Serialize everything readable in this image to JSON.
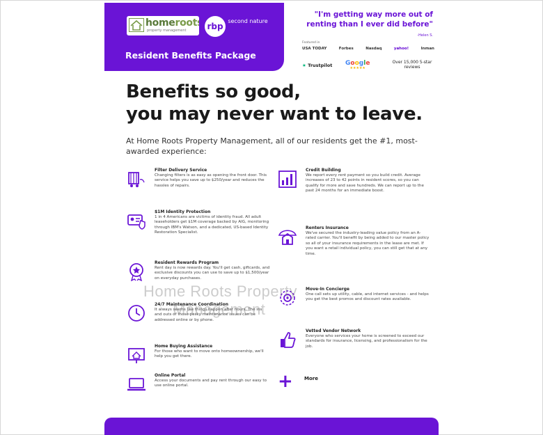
{
  "brand": {
    "logo_home": "home",
    "logo_roots": "roots",
    "logo_sub": "property management",
    "rbp": "rbp",
    "second_nature": "second nature",
    "package_title": "Resident Benefits Package"
  },
  "testimonial": {
    "quote": "\"I'm getting way more out of renting than I ever did before\"",
    "author": "-Helen S.",
    "featured_label": "Featured in",
    "press": [
      "USA TODAY",
      "Forbes",
      "Nasdaq",
      "yahoo!",
      "Inman"
    ],
    "trustpilot": "Trustpilot",
    "google": "Google",
    "google_stars": "★★★★★",
    "reviews": "Over 15,000 5-star reviews"
  },
  "headline_1": "Benefits so good,",
  "headline_2": "you may never want to leave.",
  "intro": "At Home Roots Property Management, all of our residents get the #1, most-awarded experience:",
  "left_benefits": [
    {
      "title": "Filter Delivery Service",
      "desc": "Changing filters is as easy as opening the front door. This service helps you save up to $250/year and reduces the hassles of repairs."
    },
    {
      "title": "$1M Identity Protection",
      "desc": "1 in 4 Americans are victims of identity fraud. All adult leaseholders get $1M coverage backed by AIG, monitoring through IBM's Watson, and a dedicated, US-based Identity Restoration Specialist."
    },
    {
      "title": "Resident Rewards Program",
      "desc": "Rent day is now rewards day. You'll get cash, giftcards, and exclusive discounts you can use to save up to $1,500/year on everyday purchases."
    },
    {
      "title": "24/7 Maintenance Coordination",
      "desc": "It always seems like things happen after hours. The ins and outs of those pesky maintenance issues can be addressed online or by phone."
    },
    {
      "title": "Home Buying Assistance",
      "desc": "For those who want to move onto homeownership, we'll help you get there."
    },
    {
      "title": "Online Portal",
      "desc": "Access your documents and pay rent through our easy to use online portal."
    }
  ],
  "right_benefits": [
    {
      "title": "Credit Building",
      "desc": "We report every rent payment so you build credit. Average increases of 23 to 42 points in resident scores, so you can qualify for more and save hundreds. We can report up to the past 24 months for an immediate boost."
    },
    {
      "title": "Renters Insurance",
      "desc": "We've secured the industry-leading value policy from an A-rated carrier. You'll benefit by being added to our master policy so all of your insurance requirements in the lease are met. If you want a retail individual policy, you can still get that at any time."
    },
    {
      "title": "Move-In Concierge",
      "desc": "One call sets up utility, cable, and internet services - and helps you get the best promos and discount rates available."
    },
    {
      "title": "Vetted Vendor Network",
      "desc": "Everyone who services your home is screened to exceed our standards for insurance, licensing, and professionalism for the job."
    }
  ],
  "more_label": "More",
  "watermark": {
    "line1": "Home Roots Property",
    "line2": "Management"
  },
  "colors": {
    "brand_purple": "#6a14d6",
    "trustpilot_green": "#00b67a"
  }
}
